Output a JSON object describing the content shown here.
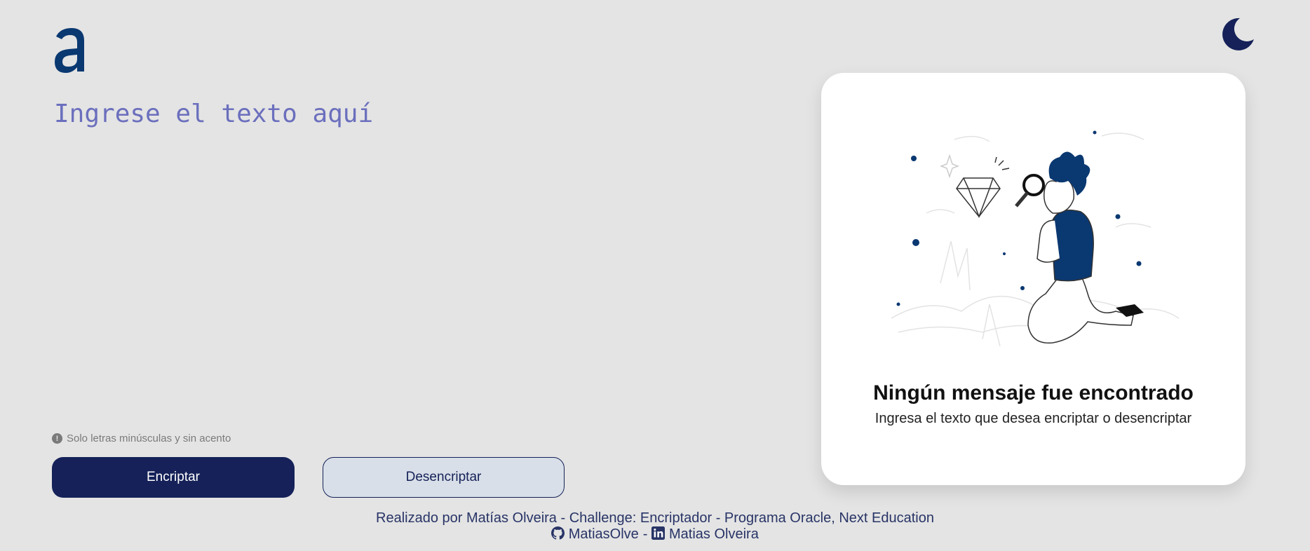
{
  "input": {
    "placeholder": "Ingrese el texto aquí",
    "value": ""
  },
  "hint": {
    "icon": "info-icon",
    "text": "Solo letras minúsculas y sin acento"
  },
  "buttons": {
    "encrypt_label": "Encriptar",
    "decrypt_label": "Desencriptar"
  },
  "output_panel": {
    "title": "Ningún mensaje fue encontrado",
    "subtitle": "Ingresa el texto que desea encriptar o desencriptar",
    "illustration": "person-with-magnifying-glass-diamond"
  },
  "footer": {
    "credits": "Realizado por Matías Olveira - Challenge: Encriptador - Programa Oracle, Next Education",
    "github_label": "MatiasOlve",
    "separator": "-",
    "linkedin_label": "Matias Olveira"
  },
  "colors": {
    "background": "#e4e4e4",
    "primary": "#152158",
    "brand_blue": "#0a3871",
    "placeholder": "#6b6fbd",
    "secondary_button_bg": "#d8dfe8"
  }
}
